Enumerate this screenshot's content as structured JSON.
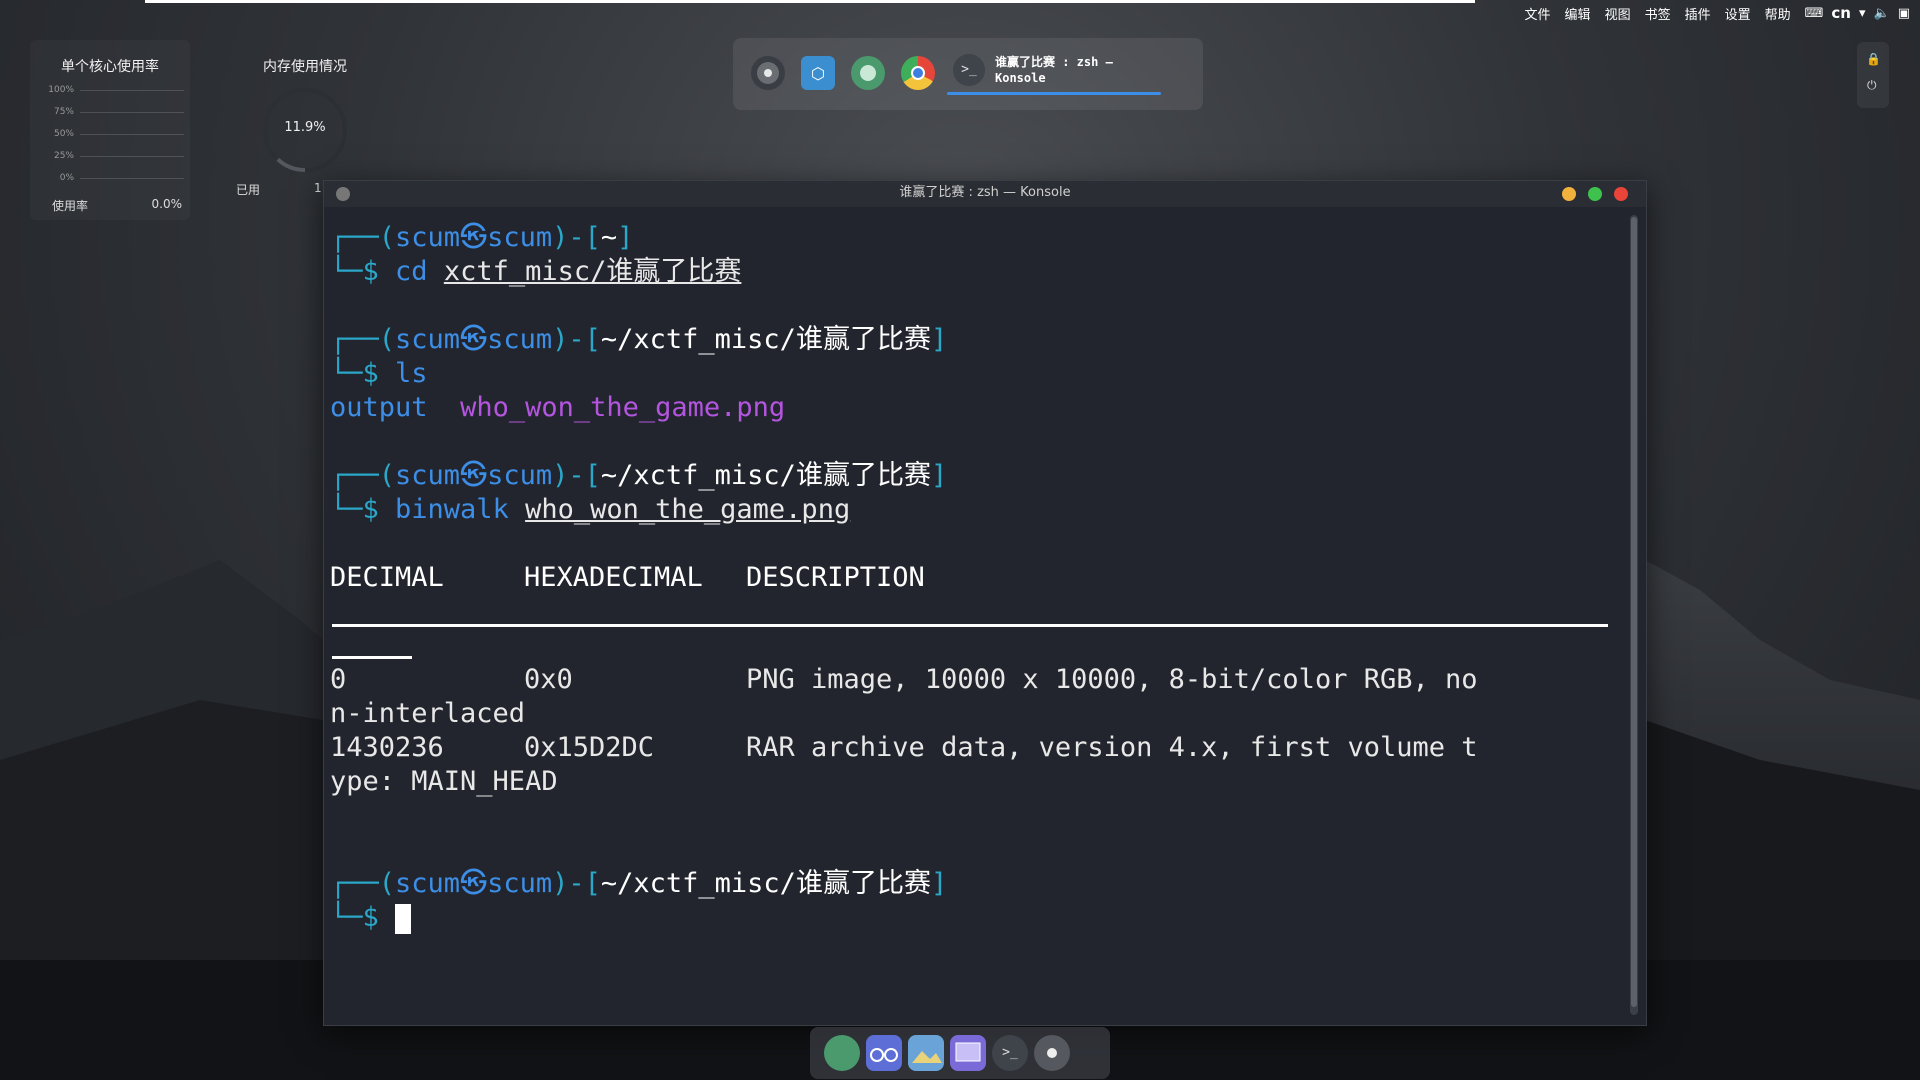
{
  "menubar": {
    "items": [
      "文件",
      "编辑",
      "视图",
      "书签",
      "插件",
      "设置",
      "帮助"
    ],
    "input_method": "cn"
  },
  "widgets": {
    "cpu": {
      "title": "单个核心使用率",
      "ticks": [
        "100%",
        "75%",
        "50%",
        "25%",
        "0%"
      ],
      "usage_label": "使用率",
      "usage_value": "0.0%"
    },
    "memory": {
      "title": "内存使用情况",
      "percent": "11.9%",
      "percent_value": 0.119,
      "used_label": "已用",
      "used_value": "1"
    }
  },
  "top_panel": {
    "task_label_line1": "谁赢了比赛 : zsh —",
    "task_label_line2": "Konsole"
  },
  "konsole": {
    "title": "谁赢了比赛 : zsh — Konsole",
    "colors": {
      "prompt_user": "#2aa7c9",
      "accent": "#3d8ee6",
      "dir_color": "#3d8ee6",
      "png_color": "#b455e0"
    }
  },
  "terminal": {
    "user": "scum",
    "host": "scum",
    "p1_open": "┌──(",
    "p1_sep": "㉿",
    "p1_close": ")-[",
    "p1_end": "]",
    "p2_prefix": "└─$ ",
    "path_home": "~",
    "path_dir": "~/xctf_misc/谁赢了比赛",
    "cmd1": "cd",
    "cmd1_arg": "xctf_misc/谁赢了比赛",
    "cmd2": "ls",
    "ls_dir": "output",
    "ls_file": "who_won_the_game.png",
    "cmd3": "binwalk",
    "cmd3_arg": "who_won_the_game.png",
    "col_decimal": "DECIMAL",
    "col_hex": "HEXADECIMAL",
    "col_desc": "DESCRIPTION",
    "r1_dec": "0",
    "r1_hex": "0x0",
    "r1_desc": "PNG image, 10000 x 10000, 8-bit/color RGB, no",
    "r1_wrap": "n-interlaced",
    "r2_dec": "1430236",
    "r2_hex": "0x15D2DC",
    "r2_desc": "RAR archive data, version 4.x, first volume t",
    "r2_wrap": "ype: MAIN_HEAD"
  }
}
